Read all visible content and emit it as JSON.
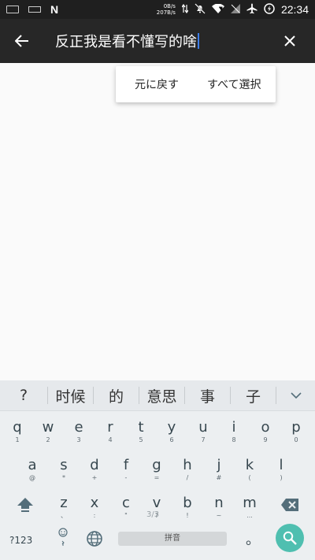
{
  "status_bar": {
    "speed_up": "0B/s",
    "speed_down": "207B/s",
    "time": "22:34"
  },
  "toolbar": {
    "query": "反正我是看不懂写的啥"
  },
  "popup": {
    "undo_label": "元に戻す",
    "select_all_label": "すべて選択"
  },
  "keyboard": {
    "candidates": [
      "?",
      "时候",
      "的",
      "意思",
      "事",
      "子"
    ],
    "row1": [
      {
        "main": "q",
        "sub": "1"
      },
      {
        "main": "w",
        "sub": "2"
      },
      {
        "main": "e",
        "sub": "3"
      },
      {
        "main": "r",
        "sub": "4"
      },
      {
        "main": "t",
        "sub": "5"
      },
      {
        "main": "y",
        "sub": "6"
      },
      {
        "main": "u",
        "sub": "7"
      },
      {
        "main": "i",
        "sub": "8"
      },
      {
        "main": "o",
        "sub": "9"
      },
      {
        "main": "p",
        "sub": "0"
      }
    ],
    "row2": [
      {
        "main": "a",
        "sub": "@"
      },
      {
        "main": "s",
        "sub": "*"
      },
      {
        "main": "d",
        "sub": "+"
      },
      {
        "main": "f",
        "sub": "-"
      },
      {
        "main": "g",
        "sub": "="
      },
      {
        "main": "h",
        "sub": "/"
      },
      {
        "main": "j",
        "sub": "#"
      },
      {
        "main": "k",
        "sub": "("
      },
      {
        "main": "l",
        "sub": ")"
      }
    ],
    "row3": [
      {
        "main": "z",
        "sub": "、"
      },
      {
        "main": "x",
        "sub": ":"
      },
      {
        "main": "c",
        "sub": "\""
      },
      {
        "main": "v",
        "sub": "?"
      },
      {
        "main": "b",
        "sub": "!"
      },
      {
        "main": "n",
        "sub": "~"
      },
      {
        "main": "m",
        "sub": "..."
      }
    ],
    "page_indicator": "3/3",
    "symbols_label": "?123",
    "space_label": "拼音",
    "period_label": "。"
  }
}
